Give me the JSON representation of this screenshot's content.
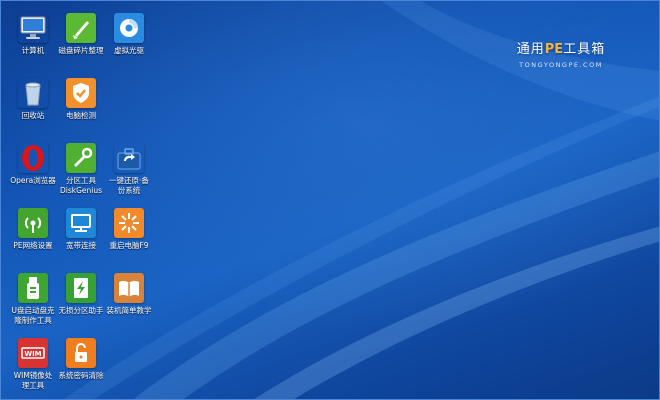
{
  "brand": {
    "prefix": "通用",
    "pe": "PE",
    "suffix": "工具箱",
    "subtitle": "TONGYONGPE.COM"
  },
  "colors": {
    "accent_pe": "#f5b33a",
    "wallpaper": "#1254b4"
  },
  "icons": [
    {
      "icon": "computer-icon",
      "line1": "计算机",
      "line2": ""
    },
    {
      "icon": "disk-defrag-icon",
      "line1": "磁盘碎片整理",
      "line2": ""
    },
    {
      "icon": "virtual-cd-icon",
      "line1": "虚拟光驱",
      "line2": ""
    },
    {
      "icon": "recycle-bin-icon",
      "line1": "回收站",
      "line2": ""
    },
    {
      "icon": "pc-check-icon",
      "line1": "电脑检测",
      "line2": ""
    },
    {
      "icon": "opera-icon",
      "line1": "Opera浏览器",
      "line2": ""
    },
    {
      "icon": "partition-tool-icon",
      "line1": "分区工具",
      "line2": "DiskGenius"
    },
    {
      "icon": "one-click-restore-icon",
      "line1": "一键还原·备",
      "line2": "份系统"
    },
    {
      "icon": "network-settings-icon",
      "line1": "PE网络设置",
      "line2": ""
    },
    {
      "icon": "broadband-icon",
      "line1": "宽带连接",
      "line2": ""
    },
    {
      "icon": "reboot-icon",
      "line1": "重启电脑F9",
      "line2": ""
    },
    {
      "icon": "usb-boot-icon",
      "line1": "U盘启动盘克",
      "line2": "隆制作工具"
    },
    {
      "icon": "lossless-partition-icon",
      "line1": "无损分区助手",
      "line2": ""
    },
    {
      "icon": "install-tutorial-icon",
      "line1": "装机简单教学",
      "line2": ""
    },
    {
      "icon": "wim-tool-icon",
      "line1": "WIM镜像处",
      "line2": "理工具"
    },
    {
      "icon": "password-clear-icon",
      "line1": "系统密码清除",
      "line2": ""
    }
  ]
}
